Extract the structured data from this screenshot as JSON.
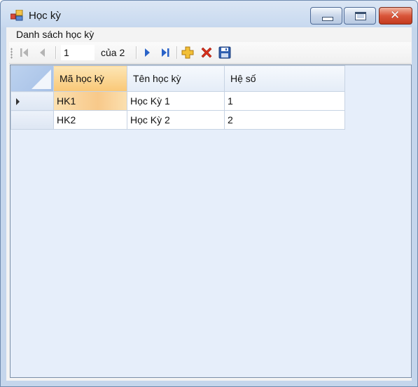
{
  "window": {
    "title": "Học kỳ"
  },
  "groupbox": {
    "title": "Danh sách học kỳ"
  },
  "navigator": {
    "position": "1",
    "count_label": "của 2"
  },
  "grid": {
    "columns": [
      "Mã học kỳ",
      "Tên học kỳ",
      "Hệ số"
    ],
    "rows": [
      [
        "HK1",
        "Học Kỳ 1",
        "1"
      ],
      [
        "HK2",
        "Học Kỳ 2",
        "2"
      ]
    ],
    "current_row": 0,
    "sorted_column": 0
  },
  "icons": {
    "first": "move-first-icon",
    "previous": "move-previous-icon",
    "next": "move-next-icon",
    "last": "move-last-icon",
    "add": "add-icon",
    "delete": "delete-icon",
    "save": "save-icon"
  },
  "colors": {
    "add": "#e8a317",
    "delete": "#d8301c",
    "nav_active": "#2a63c8",
    "nav_disabled": "#b4b4b4"
  }
}
